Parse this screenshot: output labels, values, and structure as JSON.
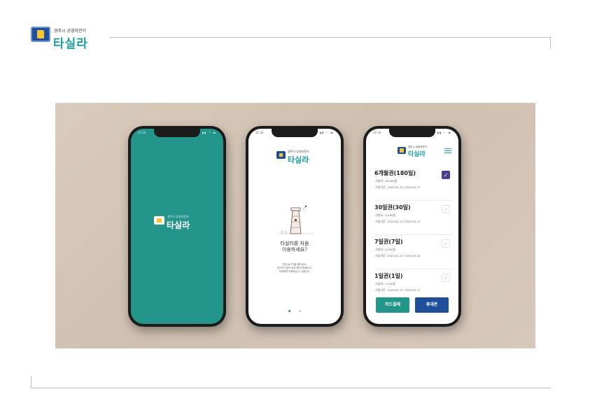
{
  "header": {
    "logo_subtitle": "경주시 공영자전거",
    "logo_title": "타실라"
  },
  "phones": {
    "status_time": "12:34",
    "splash": {
      "logo_subtitle": "경주시 공영자전거",
      "logo_title": "타실라",
      "background_color": "#23958a"
    },
    "intro": {
      "logo_subtitle": "경주시 공영자전거",
      "logo_title": "타실라",
      "title_line1": "타실라를 처음",
      "title_line2": "이용하세요?",
      "desc_line1": "먼저 로그인을 해주세요.",
      "desc_line2": "이어가기 없이 바로 확인가능합니다.",
      "desc_line3": "자세하게 이용하실 수 있습니다.",
      "page_indicator": {
        "pages": 2,
        "active": 1
      }
    },
    "plans": {
      "logo_subtitle": "경주시 공영자전거",
      "logo_title": "타실라",
      "items": [
        {
          "name": "6개월권(180일)",
          "fee": "-가입비 : 18,000원",
          "period": "-가입기간 : 2023.01.17~2023.07.17",
          "selected": true
        },
        {
          "name": "30일권(30일)",
          "fee": "-가입비 : 5,000원",
          "period": "-가입기간 : 2023.01.17~2023.02.17",
          "selected": false
        },
        {
          "name": "7일권(7일)",
          "fee": "-가입비 : 2,500원",
          "period": "-가입기간 : 2023.01.17~2023.01.24",
          "selected": false
        },
        {
          "name": "1일권(1일)",
          "fee": "-가입비 : 1,000원",
          "period": "-가입기간 : 2023.01.17~2023.01.17",
          "selected": false
        }
      ],
      "card_pay_label": "카드결제",
      "phone_pay_label": "휴대폰",
      "card_color": "#23958a",
      "phone_color": "#1f4e9a",
      "check_color": "#4b3c95"
    }
  }
}
